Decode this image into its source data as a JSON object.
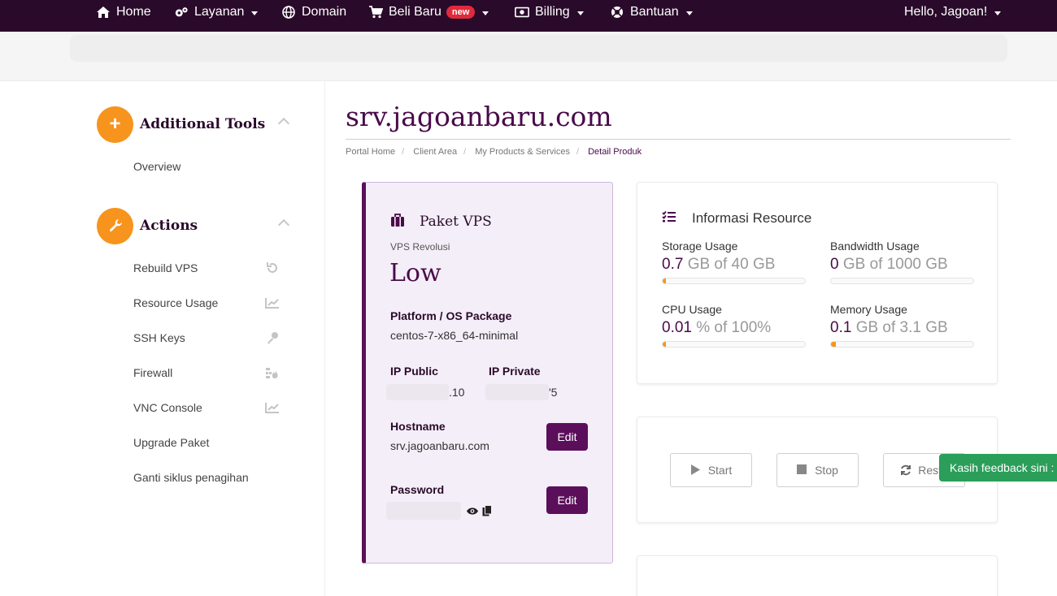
{
  "nav": {
    "home": "Home",
    "layanan": "Layanan",
    "domain": "Domain",
    "beli_baru": "Beli Baru",
    "new_badge": "new",
    "billing": "Billing",
    "bantuan": "Bantuan",
    "user_greeting": "Hello, Jagoan!"
  },
  "sidebar": {
    "tools_title": "Additional Tools",
    "tools_items": [
      "Overview"
    ],
    "actions_title": "Actions",
    "actions_items": [
      {
        "label": "Rebuild VPS",
        "icon": "undo-icon"
      },
      {
        "label": "Resource Usage",
        "icon": "chart-icon"
      },
      {
        "label": "SSH Keys",
        "icon": "key-icon"
      },
      {
        "label": "Firewall",
        "icon": "firewall-icon"
      },
      {
        "label": "VNC Console",
        "icon": "chart-icon"
      },
      {
        "label": "Upgrade Paket",
        "icon": ""
      },
      {
        "label": "Ganti siklus penagihan",
        "icon": ""
      }
    ]
  },
  "page": {
    "title": "srv.jagoanbaru.com",
    "breadcrumb": [
      "Portal Home",
      "Client Area",
      "My Products & Services",
      "Detail Produk"
    ]
  },
  "vps": {
    "header": "Paket VPS",
    "sub": "VPS Revolusi",
    "plan": "Low",
    "os_label": "Platform / OS Package",
    "os_value": "centos-7-x86_64-minimal",
    "ip_public_label": "IP Public",
    "ip_public_suffix": ".10",
    "ip_private_label": "IP Private",
    "ip_private_suffix": "'5",
    "hostname_label": "Hostname",
    "hostname_value": "srv.jagoanbaru.com",
    "password_label": "Password",
    "edit_label": "Edit"
  },
  "resource": {
    "header": "Informasi Resource",
    "items": [
      {
        "label": "Storage Usage",
        "value": "0.7",
        "rest": " GB of 40 GB",
        "fraction": 0.0175
      },
      {
        "label": "Bandwidth Usage",
        "value": "0",
        "rest": " GB of 1000 GB",
        "fraction": 0
      },
      {
        "label": "CPU Usage",
        "value": "0.01",
        "rest": " % of 100%",
        "fraction": 0.0001
      },
      {
        "label": "Memory Usage",
        "value": "0.1",
        "rest": " GB of 3.1 GB",
        "fraction": 0.032
      }
    ]
  },
  "power": {
    "start": "Start",
    "stop": "Stop",
    "restart": "Resta"
  },
  "feedback": "Kasih feedback sini :",
  "colors": {
    "nav_bg": "#2a0a2a",
    "accent": "#5b0f5b",
    "orange": "#f7941d",
    "badge": "#e02a3b",
    "feedback": "#2b9e5a"
  }
}
